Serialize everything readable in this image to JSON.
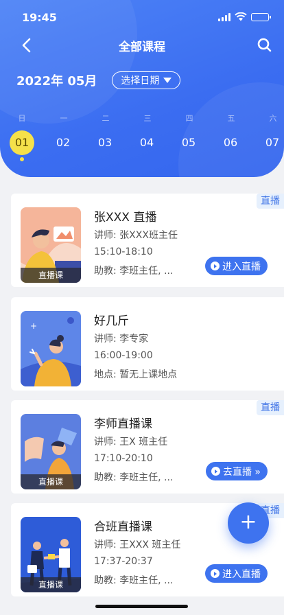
{
  "status_bar": {
    "time": "19:45"
  },
  "navbar": {
    "title": "全部课程"
  },
  "calendar": {
    "month": "2022年 05月",
    "picker_label": "选择日期",
    "weekdays": [
      "日",
      "一",
      "二",
      "三",
      "四",
      "五",
      "六"
    ],
    "dates": [
      "01",
      "02",
      "03",
      "04",
      "05",
      "06",
      "07"
    ],
    "selected_index": 0
  },
  "courses": [
    {
      "title": "张XXX 直播",
      "teacher": "讲师: 张XXX班主任",
      "time": "15:10-18:10",
      "extra": "助教: 李班主任,  ...",
      "tag": "直播",
      "thumb_caption": "直播课",
      "action": "进入直播"
    },
    {
      "title": "好几斤",
      "teacher": "讲师:  李专家",
      "time": "16:00-19:00",
      "extra": "地点: 暂无上课地点",
      "tag": "",
      "thumb_caption": "",
      "action": ""
    },
    {
      "title": "李师直播课",
      "teacher": "讲师: 王X 班主任",
      "time": "17:10-20:10",
      "extra": "助教: 李班主任,  ...",
      "tag": "直播",
      "thumb_caption": "直播课",
      "action": "去直播 »"
    },
    {
      "title": "合班直播课",
      "teacher": "讲师: 王XXX 班主任",
      "time": "17:37-20:37",
      "extra": "助教: 李班主任,  ...",
      "tag": "直播",
      "thumb_caption": "直播课",
      "action": "进入直播"
    }
  ],
  "fab": {
    "label": "+"
  },
  "colors": {
    "primary": "#3e73ef",
    "header": "#4579f3",
    "selected_date": "#f5e14a",
    "tag_bg": "#e6f0fd"
  }
}
